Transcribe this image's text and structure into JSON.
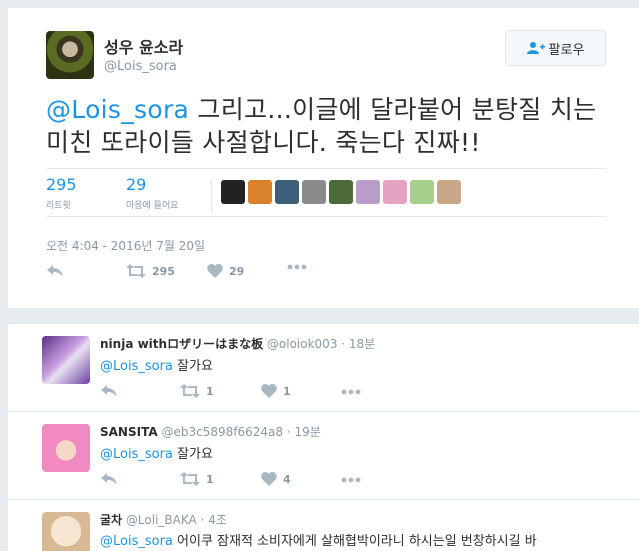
{
  "tweet": {
    "display_name": "성우 윤소라",
    "handle": "@Lois_sora",
    "follow_label": "팔로우",
    "text_mention": "@Lois_sora",
    "text_body": " 그리고...이글에 달라붙어 분탕질 치는 미친 또라이들 사절합니다. 죽는다 진짜!!",
    "retweets": "295",
    "retweets_label": "리트윗",
    "likes": "29",
    "likes_label": "마음에 들어요",
    "timestamp": "오전 4:04 - 2016년 7월 20일",
    "action_retweets": "295",
    "action_likes": "29",
    "liker_colors": [
      "#222222",
      "#d9822b",
      "#3d5f7a",
      "#8a8a8a",
      "#4d6a3a",
      "#b89dc9",
      "#e5a3c2",
      "#a8d08d",
      "#c9a889"
    ]
  },
  "replies": [
    {
      "name": "ninja withロザリーはまな板",
      "handle": "@oloiok003",
      "time": "18분",
      "mention": "@Lois_sora",
      "text": " 잘가요",
      "retweets": "1",
      "likes": "1"
    },
    {
      "name": "SANSITA",
      "handle": "@eb3c5898f6624a8",
      "time": "19분",
      "mention": "@Lois_sora",
      "text": " 잘가요",
      "retweets": "1",
      "likes": "4"
    },
    {
      "name": "굴차",
      "handle": "@Loli_BAKA",
      "time": "4조",
      "mention": "@Lois_sora",
      "text": " 어이쿠 잠재적 소비자에게 살해협박이라니 하시는일 번창하시길 바"
    }
  ]
}
